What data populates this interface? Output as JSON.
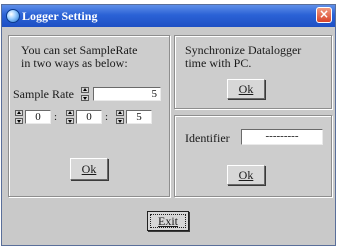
{
  "window": {
    "title": "Logger Setting",
    "close_label": "×"
  },
  "sample_rate_panel": {
    "instruction_line1": "You can set SampleRate",
    "instruction_line2": "in two ways as below:",
    "sample_rate_label": "Sample Rate",
    "sample_rate_value": "5",
    "hours_value": "0",
    "minutes_value": "0",
    "seconds_value": "5",
    "separator": ":",
    "ok_label": "Ok"
  },
  "sync_panel": {
    "line1": "Synchronize Datalogger",
    "line2": "time with PC.",
    "ok_label": "Ok"
  },
  "identifier_panel": {
    "label": "Identifier",
    "value": "---------",
    "ok_label": "Ok"
  },
  "exit_label": "Exit"
}
